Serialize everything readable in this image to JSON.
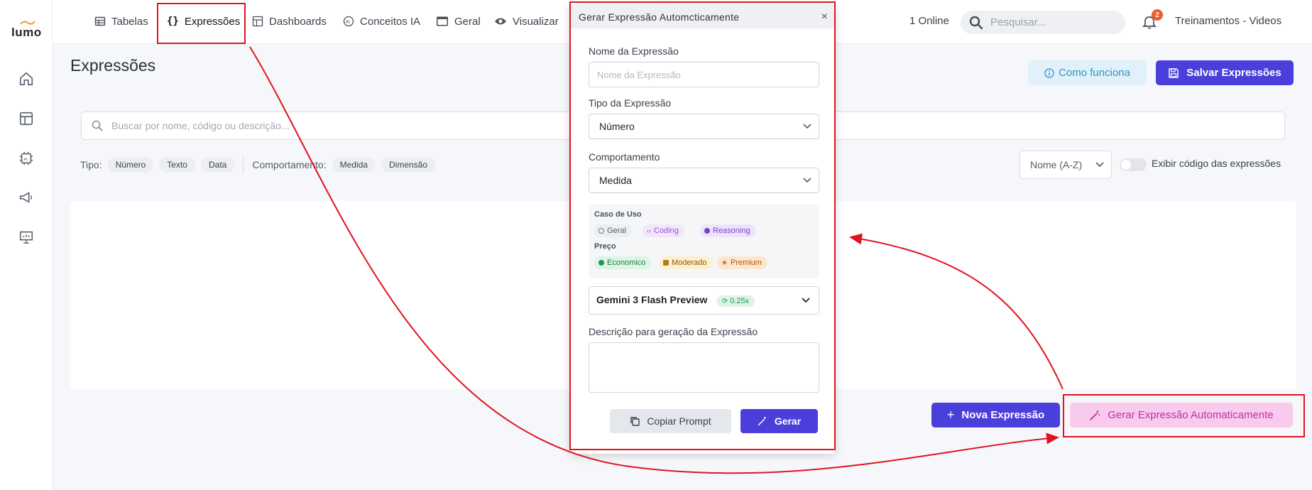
{
  "app": {
    "logo_text": "lumo"
  },
  "nav": {
    "tabelas": "Tabelas",
    "expressoes": "Expressões",
    "dashboards": "Dashboards",
    "conceitos": "Conceitos IA",
    "geral": "Geral",
    "visualizar": "Visualizar"
  },
  "header": {
    "online": "1 Online",
    "search_placeholder": "Pesquisar...",
    "notifications_count": "2",
    "user": "Treinamentos - Videos"
  },
  "page": {
    "title": "Expressões",
    "how_button": "Como funciona",
    "save_button": "Salvar Expressões",
    "search_placeholder": "Buscar por nome, código ou descrição...",
    "filter_type_label": "Tipo:",
    "filter_types": [
      "Número",
      "Texto",
      "Data"
    ],
    "filter_behavior_label": "Comportamento:",
    "filter_behaviors": [
      "Medida",
      "Dimensão"
    ],
    "sort_value": "Nome (A-Z)",
    "show_code_label": "Exibir código das expressões",
    "show_code_enabled": false,
    "new_button": "Nova Expressão",
    "auto_button": "Gerar Expressão Automaticamente"
  },
  "modal": {
    "title": "Gerar Expressão Automcticamente",
    "name_label": "Nome da Expressão",
    "name_placeholder": "Nome da Expressão",
    "type_label": "Tipo da Expressão",
    "type_value": "Número",
    "behavior_label": "Comportamento",
    "behavior_value": "Medida",
    "use_case_label": "Caso de Uso",
    "use_cases": [
      {
        "label": "Geral",
        "color": "#777b85"
      },
      {
        "label": "Coding",
        "color": "#9b4fd6"
      },
      {
        "label": "Reasoning",
        "color": "#7a3fd0"
      }
    ],
    "price_label": "Preço",
    "prices": [
      {
        "label": "Economico",
        "color": "#21965c"
      },
      {
        "label": "Moderado",
        "color": "#b7791f"
      },
      {
        "label": "Premium",
        "color": "#d06a12"
      }
    ],
    "model_name": "Gemini 3 Flash Preview",
    "model_multiplier": "0.25x",
    "description_label": "Descrição para geração da Expressão",
    "copy_button": "Copiar Prompt",
    "generate_button": "Gerar"
  },
  "colors": {
    "primary": "#4b3fdc",
    "annotation": "#e0141f",
    "auto_bg": "#f8cbed",
    "auto_text": "#c22ea6"
  }
}
